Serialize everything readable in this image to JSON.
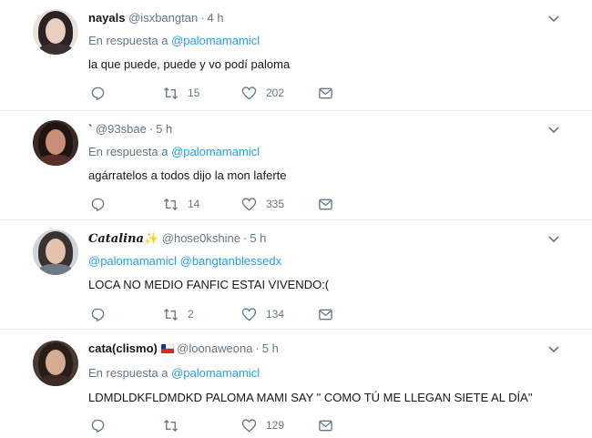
{
  "colors": {
    "link": "#1da1f2",
    "muted": "#657786",
    "text": "#14171a",
    "divider": "#e6ecf0"
  },
  "tweets": [
    {
      "name": "nayals",
      "handle": "@isxbangtan",
      "time": "4 h",
      "reply_prefix": "En respuesta a",
      "reply_to": "@palomamamicl",
      "text": "la que puede, puede y vo podí paloma",
      "retweets": "15",
      "likes": "202"
    },
    {
      "name": "`",
      "handle": "@93sbae",
      "time": "5 h",
      "reply_prefix": "En respuesta a",
      "reply_to": "@palomamamicl",
      "text": "agárratelos a todos dijo la mon laferte",
      "retweets": "14",
      "likes": "335"
    },
    {
      "name": "Catalina",
      "name_emoji": "✨",
      "handle": "@hose0kshine",
      "time": "5 h",
      "reply_prefix": "",
      "reply_to": "@palomamamicl",
      "reply_to_2": "@bangtanblessedx",
      "text": "LOCA NO MEDIO FANFIC ESTAI VIVENDO:(",
      "retweets": "2",
      "likes": "134"
    },
    {
      "name": "cata(clismo)",
      "handle": "@loonaweona",
      "time": "5 h",
      "reply_prefix": "En respuesta a",
      "reply_to": "@palomamamicl",
      "text": "LDMDLDKFLDMDKD PALOMA MAMI SAY \" COMO TÚ ME LLEGAN SIETE AL DÍA\"",
      "retweets": "",
      "likes": "129"
    }
  ]
}
